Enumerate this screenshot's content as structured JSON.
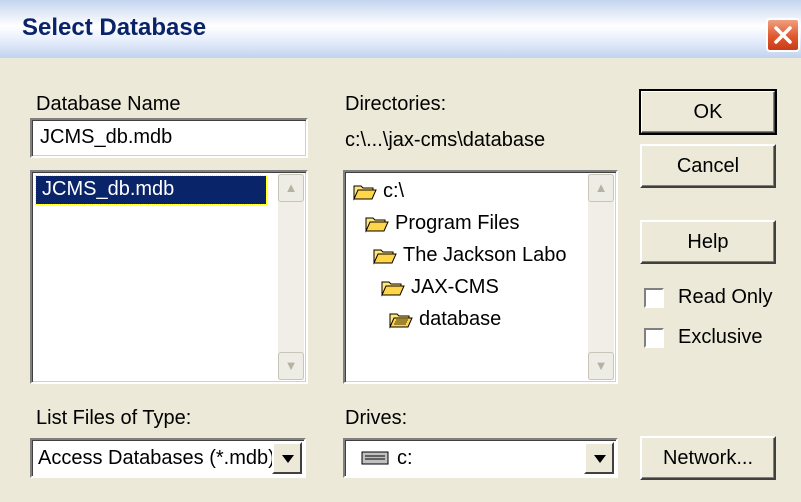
{
  "window": {
    "title": "Select Database"
  },
  "database_name": {
    "label": "Database Name",
    "value": "JCMS_db.mdb",
    "files": [
      "JCMS_db.mdb"
    ]
  },
  "directories": {
    "label": "Directories:",
    "current_path": "c:\\...\\jax-cms\\database",
    "tree": [
      "c:\\",
      "Program Files",
      "The Jackson Labo",
      "JAX-CMS",
      "database"
    ]
  },
  "file_type": {
    "label": "List Files of Type:",
    "value": "Access Databases (*.mdb)"
  },
  "drives": {
    "label": "Drives:",
    "value": "c:"
  },
  "buttons": {
    "ok": "OK",
    "cancel": "Cancel",
    "help": "Help",
    "network": "Network..."
  },
  "options": {
    "read_only": "Read Only",
    "exclusive": "Exclusive"
  },
  "colors": {
    "face": "#ece9d8",
    "selection": "#0a246a",
    "title_text": "#0a246a",
    "folder": "#ffe680"
  }
}
